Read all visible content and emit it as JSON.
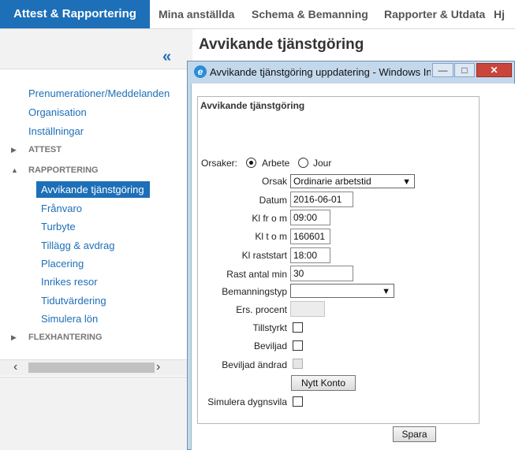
{
  "nav": {
    "active_tab": "Attest & Rapportering",
    "tabs": [
      "Mina anställda",
      "Schema & Bemanning",
      "Rapporter & Utdata",
      "Hj"
    ]
  },
  "sidebar": {
    "collapse_icon": "«",
    "links": [
      "Prenumerationer/Meddelanden",
      "Organisation",
      "Inställningar"
    ],
    "sections": {
      "attest": "ATTEST",
      "rapportering": "RAPPORTERING",
      "flexhantering": "FLEXHANTERING"
    },
    "rapportering_items": [
      "Avvikande tjänstgöring",
      "Frånvaro",
      "Turbyte",
      "Tillägg & avdrag",
      "Placering",
      "Inrikes resor",
      "Tidutvärdering",
      "Simulera lön"
    ],
    "selected": "Avvikande tjänstgöring"
  },
  "page": {
    "title": "Avvikande tjänstgöring"
  },
  "modal": {
    "title": "Avvikande tjänstgöring uppdatering - Windows Int...",
    "minimize": "—",
    "maximize": "□",
    "close": "✕",
    "form_header": "Avvikande tjänstgöring",
    "orsaker": {
      "label": "Orsaker:",
      "options": [
        "Arbete",
        "Jour"
      ],
      "selected": "Arbete"
    },
    "fields": {
      "orsak": {
        "label": "Orsak",
        "value": "Ordinarie arbetstid"
      },
      "datum": {
        "label": "Datum",
        "value": "2016-06-01"
      },
      "kl_from": {
        "label": "Kl fr o m",
        "value": "09:00"
      },
      "kl_tom": {
        "label": "Kl t o m",
        "value": "160601"
      },
      "kl_raststart": {
        "label": "Kl raststart",
        "value": "18:00"
      },
      "rast_antal_min": {
        "label": "Rast antal min",
        "value": "30"
      },
      "bemanningstyp": {
        "label": "Bemanningstyp",
        "value": ""
      },
      "ers_procent": {
        "label": "Ers. procent",
        "value": ""
      },
      "tillstyrkt": {
        "label": "Tillstyrkt",
        "checked": false
      },
      "beviljad": {
        "label": "Beviljad",
        "checked": false
      },
      "beviljad_andrad": {
        "label": "Beviljad ändrad",
        "checked": false,
        "disabled": true
      },
      "simulera_dygnsvila": {
        "label": "Simulera dygnsvila",
        "checked": false
      }
    },
    "nytt_konto_label": "Nytt Konto",
    "spara_label": "Spara"
  },
  "colors": {
    "accent": "#1d6fb8",
    "modal_frame": "#c4d8ec"
  }
}
